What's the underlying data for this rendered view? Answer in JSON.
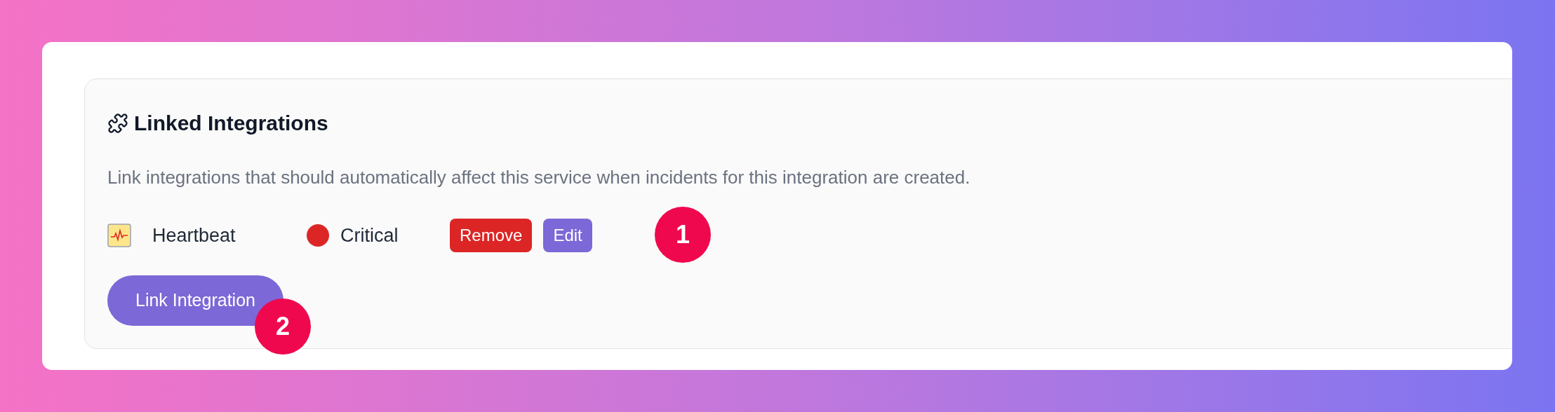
{
  "section": {
    "title": "Linked Integrations",
    "description": "Link integrations that should automatically affect this service when incidents for this integration are created."
  },
  "integrations": [
    {
      "name": "Heartbeat",
      "severity": "Critical",
      "color": "#dc2626",
      "actions": [
        "Remove",
        "Edit"
      ]
    }
  ],
  "link_button": "Link Integration",
  "callouts": [
    "1",
    "2"
  ]
}
